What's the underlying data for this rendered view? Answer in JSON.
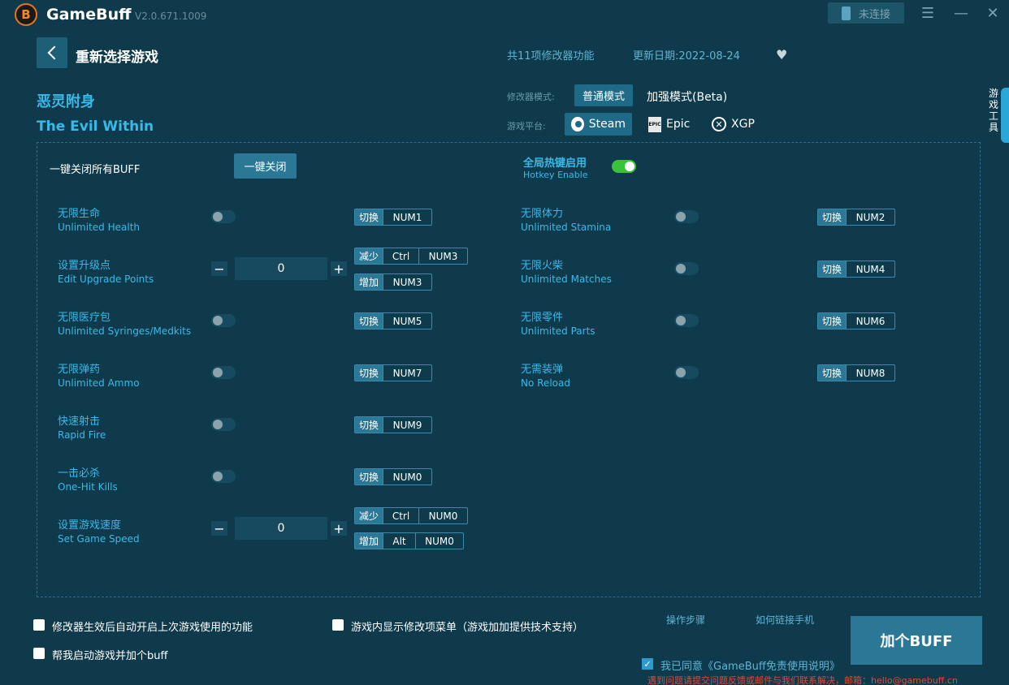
{
  "titlebar": {
    "logo_glyph": "B",
    "app_name": "GameBuff",
    "version": "V2.0.671.1009",
    "connect_label": "未连接"
  },
  "header": {
    "back_title": "重新选择游戏",
    "feature_count": "共11项修改器功能",
    "update_date": "更新日期:2022-08-24"
  },
  "game": {
    "name_cn": "恶灵附身",
    "name_en": "The Evil Within"
  },
  "mode": {
    "label": "修改器模式:",
    "options": [
      "普通模式",
      "加强模式(Beta)"
    ],
    "selected": "普通模式"
  },
  "platform": {
    "label": "游戏平台:",
    "options": [
      "Steam",
      "Epic",
      "XGP"
    ],
    "selected": "Steam"
  },
  "side_tab": [
    "游",
    "戏",
    "工",
    "具"
  ],
  "controls": {
    "close_all_label": "一键关闭所有BUFF",
    "close_all_button": "一键关闭",
    "hotkey_cn": "全局热键启用",
    "hotkey_en": "Hotkey Enable",
    "hotkey_enabled": true
  },
  "features_left": [
    {
      "cn": "无限生命",
      "en": "Unlimited Health",
      "tag": "切换",
      "key": "NUM1"
    },
    {
      "cn": "设置升级点",
      "en": "Edit Upgrade Points",
      "value": "0",
      "dec": {
        "tag": "减少",
        "keys": [
          "Ctrl",
          "NUM3"
        ]
      },
      "inc": {
        "tag": "增加",
        "keys": [
          "NUM3"
        ]
      }
    },
    {
      "cn": "无限医疗包",
      "en": "Unlimited Syringes/Medkits",
      "tag": "切换",
      "key": "NUM5"
    },
    {
      "cn": "无限弹药",
      "en": "Unlimited Ammo",
      "tag": "切换",
      "key": "NUM7"
    },
    {
      "cn": "快速射击",
      "en": "Rapid Fire",
      "tag": "切换",
      "key": "NUM9"
    },
    {
      "cn": "一击必杀",
      "en": "One-Hit Kills",
      "tag": "切换",
      "key": "NUM0"
    },
    {
      "cn": "设置游戏速度",
      "en": "Set Game Speed",
      "value": "0",
      "dec": {
        "tag": "减少",
        "keys": [
          "Ctrl",
          "NUM0"
        ]
      },
      "inc": {
        "tag": "增加",
        "keys": [
          "Alt",
          "NUM0"
        ]
      }
    }
  ],
  "features_right": [
    {
      "cn": "无限体力",
      "en": "Unlimited Stamina",
      "tag": "切换",
      "key": "NUM2"
    },
    {
      "cn": "无限火柴",
      "en": "Unlimited Matches",
      "tag": "切换",
      "key": "NUM4"
    },
    {
      "cn": "无限零件",
      "en": "Unlimited Parts",
      "tag": "切换",
      "key": "NUM6"
    },
    {
      "cn": "无需装弹",
      "en": "No Reload",
      "tag": "切换",
      "key": "NUM8"
    }
  ],
  "bottom": {
    "opt_autostart": "修改器生效后自动开启上次游戏使用的功能",
    "opt_launch": "帮我启动游戏并加个buff",
    "opt_ingame_menu": "游戏内显示修改项菜单（游戏加加提供技术支持）",
    "link_steps": "操作步骤",
    "link_phone": "如何链接手机",
    "add_buff": "加个BUFF",
    "agree": "我已同意《GameBuff免责使用说明》",
    "contact": "遇到问题请提交问题反馈或邮件与我们联系解决，邮箱：hello@gamebuff.cn"
  },
  "colors": {
    "background": "#0f3a4c",
    "accent": "#3ab9e8",
    "button": "#2b7896",
    "switch_on": "#3ac23a",
    "warning": "#e04a36"
  }
}
